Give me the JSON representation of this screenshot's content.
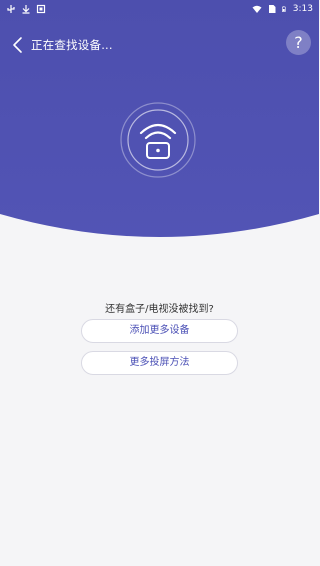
{
  "status_bar": {
    "time": "3:13",
    "icons": [
      "usb-icon",
      "download-icon",
      "notification-icon",
      "wifi-icon",
      "sim-icon",
      "battery-icon"
    ]
  },
  "toolbar": {
    "title": "正在查找设备...",
    "help_label": "?"
  },
  "colors": {
    "primary": "#4f4fb0",
    "button_text": "#4a4fb5",
    "background": "#f5f5f7"
  },
  "scanner": {
    "icon": "wifi-device-icon"
  },
  "help_section": {
    "question": "还有盒子/电视没被找到?",
    "add_device_label": "添加更多设备",
    "more_cast_label": "更多投屏方法"
  }
}
